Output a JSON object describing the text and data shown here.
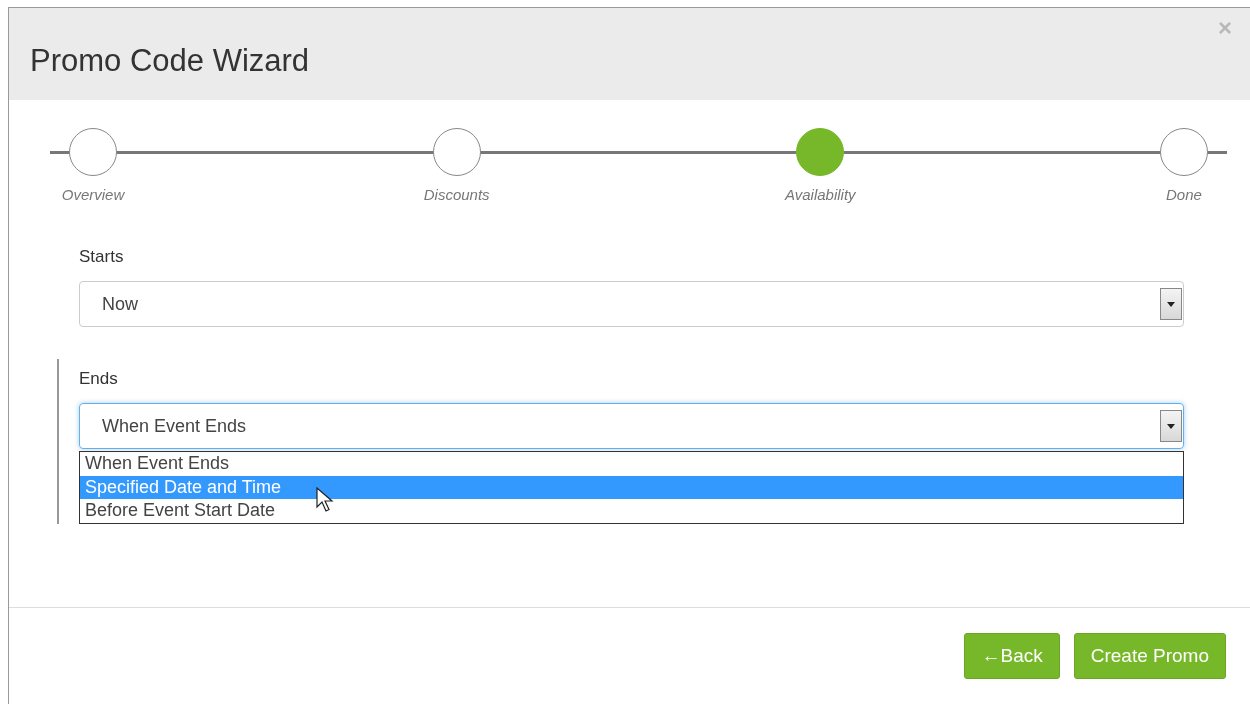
{
  "dialog": {
    "title": "Promo Code Wizard",
    "close": "×"
  },
  "steps": [
    {
      "label": "Overview",
      "selected": false
    },
    {
      "label": "Discounts",
      "selected": false
    },
    {
      "label": "Availability",
      "selected": true
    },
    {
      "label": "Done",
      "selected": false
    }
  ],
  "fields": [
    {
      "label": "Starts",
      "value": "Now",
      "focused": false
    },
    {
      "label": "Ends",
      "value": "When Event Ends",
      "focused": true,
      "options": [
        {
          "label": "When Event Ends",
          "highlighted": false
        },
        {
          "label": "Specified Date and Time",
          "highlighted": true
        },
        {
          "label": "Before Event Start Date",
          "highlighted": false
        }
      ]
    }
  ],
  "buttons": [
    {
      "label": "←Back"
    },
    {
      "label": "Create Promo"
    }
  ]
}
